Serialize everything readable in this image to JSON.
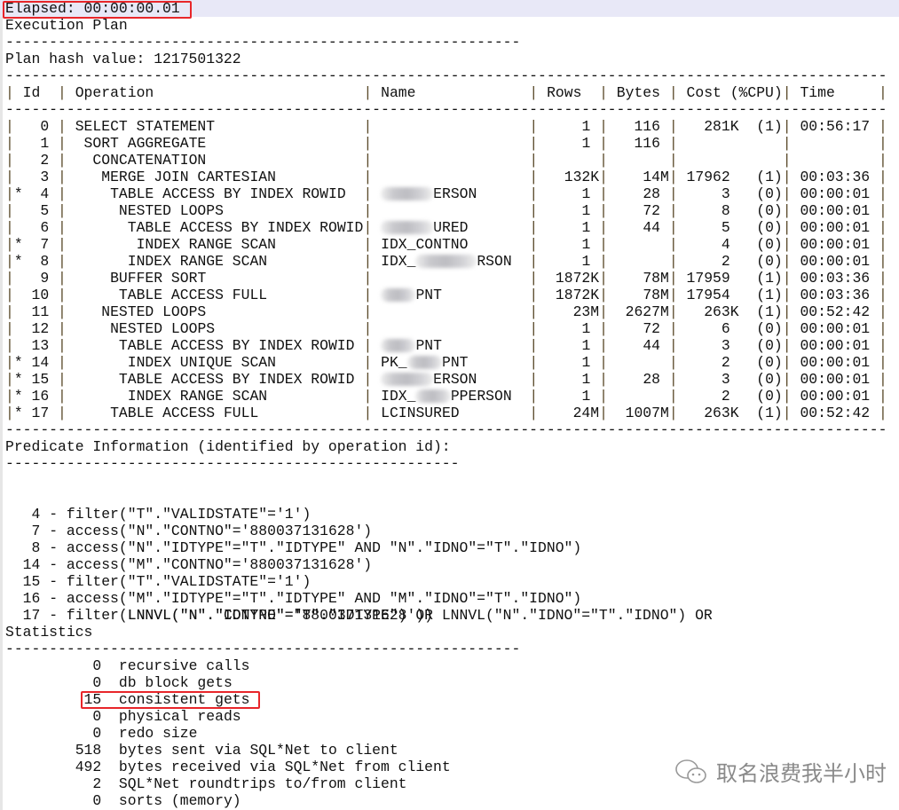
{
  "elapsed": "Elapsed: 00:00:00.01",
  "plan_title": "Execution Plan",
  "plan_hash": "Plan hash value: 1217501322",
  "headers": {
    "id": "Id",
    "operation": "Operation",
    "name": "Name",
    "rows": "Rows",
    "bytes": "Bytes",
    "cost": "Cost (%CPU)",
    "time": "Time"
  },
  "plan_rows": [
    {
      "star": "",
      "id": "0",
      "depth": 0,
      "op": "SELECT STATEMENT",
      "name": {
        "pre": "",
        "blur": 0,
        "post": ""
      },
      "rows": "1",
      "bytes": "116",
      "cost": "281K",
      "cpu": "(1)",
      "time": "00:56:17"
    },
    {
      "star": "",
      "id": "1",
      "depth": 1,
      "op": "SORT AGGREGATE",
      "name": {
        "pre": "",
        "blur": 0,
        "post": ""
      },
      "rows": "1",
      "bytes": "116",
      "cost": "",
      "cpu": "",
      "time": ""
    },
    {
      "star": "",
      "id": "2",
      "depth": 2,
      "op": "CONCATENATION",
      "name": {
        "pre": "",
        "blur": 0,
        "post": ""
      },
      "rows": "",
      "bytes": "",
      "cost": "",
      "cpu": "",
      "time": ""
    },
    {
      "star": "",
      "id": "3",
      "depth": 3,
      "op": "MERGE JOIN CARTESIAN",
      "name": {
        "pre": "",
        "blur": 0,
        "post": ""
      },
      "rows": "132K",
      "bytes": "14M",
      "cost": "17962",
      "cpu": "(1)",
      "time": "00:03:36"
    },
    {
      "star": "*",
      "id": "4",
      "depth": 4,
      "op": "TABLE ACCESS BY INDEX ROWID",
      "name": {
        "pre": "",
        "blur": 6,
        "post": "ERSON"
      },
      "rows": "1",
      "bytes": "28",
      "cost": "3",
      "cpu": "(0)",
      "time": "00:00:01"
    },
    {
      "star": "",
      "id": "5",
      "depth": 5,
      "op": "NESTED LOOPS",
      "name": {
        "pre": "",
        "blur": 0,
        "post": ""
      },
      "rows": "1",
      "bytes": "72",
      "cost": "8",
      "cpu": "(0)",
      "time": "00:00:01"
    },
    {
      "star": "",
      "id": "6",
      "depth": 6,
      "op": "TABLE ACCESS BY INDEX ROWID",
      "name": {
        "pre": "",
        "blur": 6,
        "post": "URED"
      },
      "rows": "1",
      "bytes": "44",
      "cost": "5",
      "cpu": "(0)",
      "time": "00:00:01"
    },
    {
      "star": "*",
      "id": "7",
      "depth": 7,
      "op": "INDEX RANGE SCAN",
      "name": {
        "pre": "IDX_CONTNO",
        "blur": 0,
        "post": ""
      },
      "rows": "1",
      "bytes": "",
      "cost": "4",
      "cpu": "(0)",
      "time": "00:00:01"
    },
    {
      "star": "*",
      "id": "8",
      "depth": 6,
      "op": "INDEX RANGE SCAN",
      "name": {
        "pre": "IDX_",
        "blur": 7,
        "post": "RSON"
      },
      "rows": "1",
      "bytes": "",
      "cost": "2",
      "cpu": "(0)",
      "time": "00:00:01"
    },
    {
      "star": "",
      "id": "9",
      "depth": 4,
      "op": "BUFFER SORT",
      "name": {
        "pre": "",
        "blur": 0,
        "post": ""
      },
      "rows": "1872K",
      "bytes": "78M",
      "cost": "17959",
      "cpu": "(1)",
      "time": "00:03:36"
    },
    {
      "star": "",
      "id": "10",
      "depth": 5,
      "op": "TABLE ACCESS FULL",
      "name": {
        "pre": "",
        "blur": 4,
        "post": "PNT"
      },
      "rows": "1872K",
      "bytes": "78M",
      "cost": "17954",
      "cpu": "(1)",
      "time": "00:03:36"
    },
    {
      "star": "",
      "id": "11",
      "depth": 3,
      "op": "NESTED LOOPS",
      "name": {
        "pre": "",
        "blur": 0,
        "post": ""
      },
      "rows": "23M",
      "bytes": "2627M",
      "cost": "263K",
      "cpu": "(1)",
      "time": "00:52:42"
    },
    {
      "star": "",
      "id": "12",
      "depth": 4,
      "op": "NESTED LOOPS",
      "name": {
        "pre": "",
        "blur": 0,
        "post": ""
      },
      "rows": "1",
      "bytes": "72",
      "cost": "6",
      "cpu": "(0)",
      "time": "00:00:01"
    },
    {
      "star": "",
      "id": "13",
      "depth": 5,
      "op": "TABLE ACCESS BY INDEX ROWID",
      "name": {
        "pre": "",
        "blur": 4,
        "post": "PNT"
      },
      "rows": "1",
      "bytes": "44",
      "cost": "3",
      "cpu": "(0)",
      "time": "00:00:01"
    },
    {
      "star": "*",
      "id": "14",
      "depth": 6,
      "op": "INDEX UNIQUE SCAN",
      "name": {
        "pre": "PK_",
        "blur": 4,
        "post": "PNT"
      },
      "rows": "1",
      "bytes": "",
      "cost": "2",
      "cpu": "(0)",
      "time": "00:00:01"
    },
    {
      "star": "*",
      "id": "15",
      "depth": 5,
      "op": "TABLE ACCESS BY INDEX ROWID",
      "name": {
        "pre": "",
        "blur": 6,
        "post": "ERSON"
      },
      "rows": "1",
      "bytes": "28",
      "cost": "3",
      "cpu": "(0)",
      "time": "00:00:01"
    },
    {
      "star": "*",
      "id": "16",
      "depth": 6,
      "op": "INDEX RANGE SCAN",
      "name": {
        "pre": "IDX_",
        "blur": 4,
        "post": "PPERSON"
      },
      "rows": "1",
      "bytes": "",
      "cost": "2",
      "cpu": "(0)",
      "time": "00:00:01"
    },
    {
      "star": "*",
      "id": "17",
      "depth": 4,
      "op": "TABLE ACCESS FULL",
      "name": {
        "pre": "LCINSURED",
        "blur": 0,
        "post": ""
      },
      "rows": "24M",
      "bytes": "1007M",
      "cost": "263K",
      "cpu": "(1)",
      "time": "00:52:42"
    }
  ],
  "predicate_title": "Predicate Information (identified by operation id):",
  "predicates": [
    {
      "id": "4",
      "text": "filter(\"T\".\"VALIDSTATE\"='1')"
    },
    {
      "id": "7",
      "text": "access(\"N\".\"CONTNO\"='880037131628')"
    },
    {
      "id": "8",
      "text": "access(\"N\".\"IDTYPE\"=\"T\".\"IDTYPE\" AND \"N\".\"IDNO\"=\"T\".\"IDNO\")"
    },
    {
      "id": "14",
      "text": "access(\"M\".\"CONTNO\"='880037131628')"
    },
    {
      "id": "15",
      "text": "filter(\"T\".\"VALIDSTATE\"='1')"
    },
    {
      "id": "16",
      "text": "access(\"M\".\"IDTYPE\"=\"T\".\"IDTYPE\" AND \"M\".\"IDNO\"=\"T\".\"IDNO\")"
    },
    {
      "id": "17",
      "text": "filter(LNNVL(\"N\".\"IDTYPE\"=\"T\".\"IDTYPE\") OR LNNVL(\"N\".\"IDNO\"=\"T\".\"IDNO\") OR"
    }
  ],
  "predicate_continuation": "LNNVL(\"N\".\"CONTNO\"='880037131628'))",
  "statistics_title": "Statistics",
  "statistics": [
    {
      "value": "0",
      "label": "recursive calls"
    },
    {
      "value": "0",
      "label": "db block gets"
    },
    {
      "value": "15",
      "label": "consistent gets",
      "highlighted": true
    },
    {
      "value": "0",
      "label": "physical reads"
    },
    {
      "value": "0",
      "label": "redo size"
    },
    {
      "value": "518",
      "label": "bytes sent via SQL*Net to client"
    },
    {
      "value": "492",
      "label": "bytes received via SQL*Net from client"
    },
    {
      "value": "2",
      "label": "SQL*Net roundtrips to/from client"
    },
    {
      "value": "0",
      "label": "sorts (memory)"
    }
  ],
  "watermark": "取名浪费我半小时",
  "colors": {
    "highlight_bg": "#e8e8f7",
    "red_box": "#e8262a"
  }
}
